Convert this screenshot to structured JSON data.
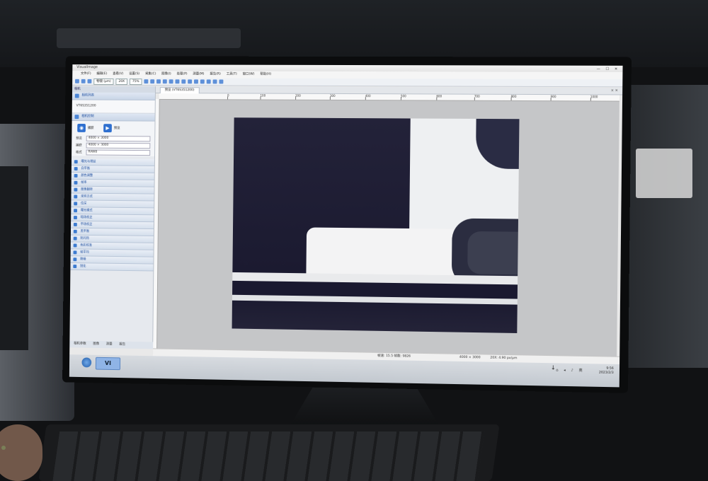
{
  "window": {
    "title": "VisualImage",
    "controls": "— ☐ ✕"
  },
  "menu": [
    "文件(F)",
    "编辑(E)",
    "查看(V)",
    "设置(S)",
    "采集(C)",
    "图像(I)",
    "处理(P)",
    "测量(M)",
    "报告(R)",
    "工具(T)",
    "窗口(W)",
    "帮助(H)"
  ],
  "toolbar": {
    "objective": "物镜 (μm)",
    "magnification": "20X",
    "zoom": "75%"
  },
  "left_panel": {
    "header": "相机",
    "camera_section": "相机列表",
    "camera_name": "VT6S351200",
    "capture_section": "相机控制",
    "capture_button": "捕获",
    "preview_button": "预览",
    "settings": [
      {
        "label": "预览",
        "value": "4000 × 3000"
      },
      {
        "label": "捕获",
        "value": "4000 × 3000"
      },
      {
        "label": "格式",
        "value": "RAW8"
      }
    ],
    "tools": [
      "曝光与增益",
      "白平衡",
      "颜色调整",
      "帧率",
      "图像翻转",
      "采样方式",
      "位深",
      "曝光模式",
      "暗场校正",
      "平场校正",
      "黑平衡",
      "防闪烁",
      "色彩校准",
      "帧平均",
      "降噪",
      "锐化"
    ],
    "bottom_tabs": [
      "相机参数",
      "图像",
      "测量",
      "报告"
    ]
  },
  "document": {
    "tab": "预览 (VT6S351200)",
    "ruler_ticks": [
      "0",
      "100",
      "200",
      "300",
      "400",
      "500",
      "600",
      "700",
      "800",
      "900",
      "1000"
    ]
  },
  "statusbar": {
    "frame_info": "帧速: 15.5  帧数: 9826",
    "resolution": "4000 × 3000",
    "scale": "20X: 4.90 px/μm"
  },
  "taskbar": {
    "app_label": "VI",
    "lang": "英",
    "time": "9:56",
    "date": "2023/2/3"
  },
  "colors": {
    "accent": "#2e6fcf",
    "micrograph_dark": "#1d1c34",
    "micrograph_metal": "#eef0f2"
  }
}
